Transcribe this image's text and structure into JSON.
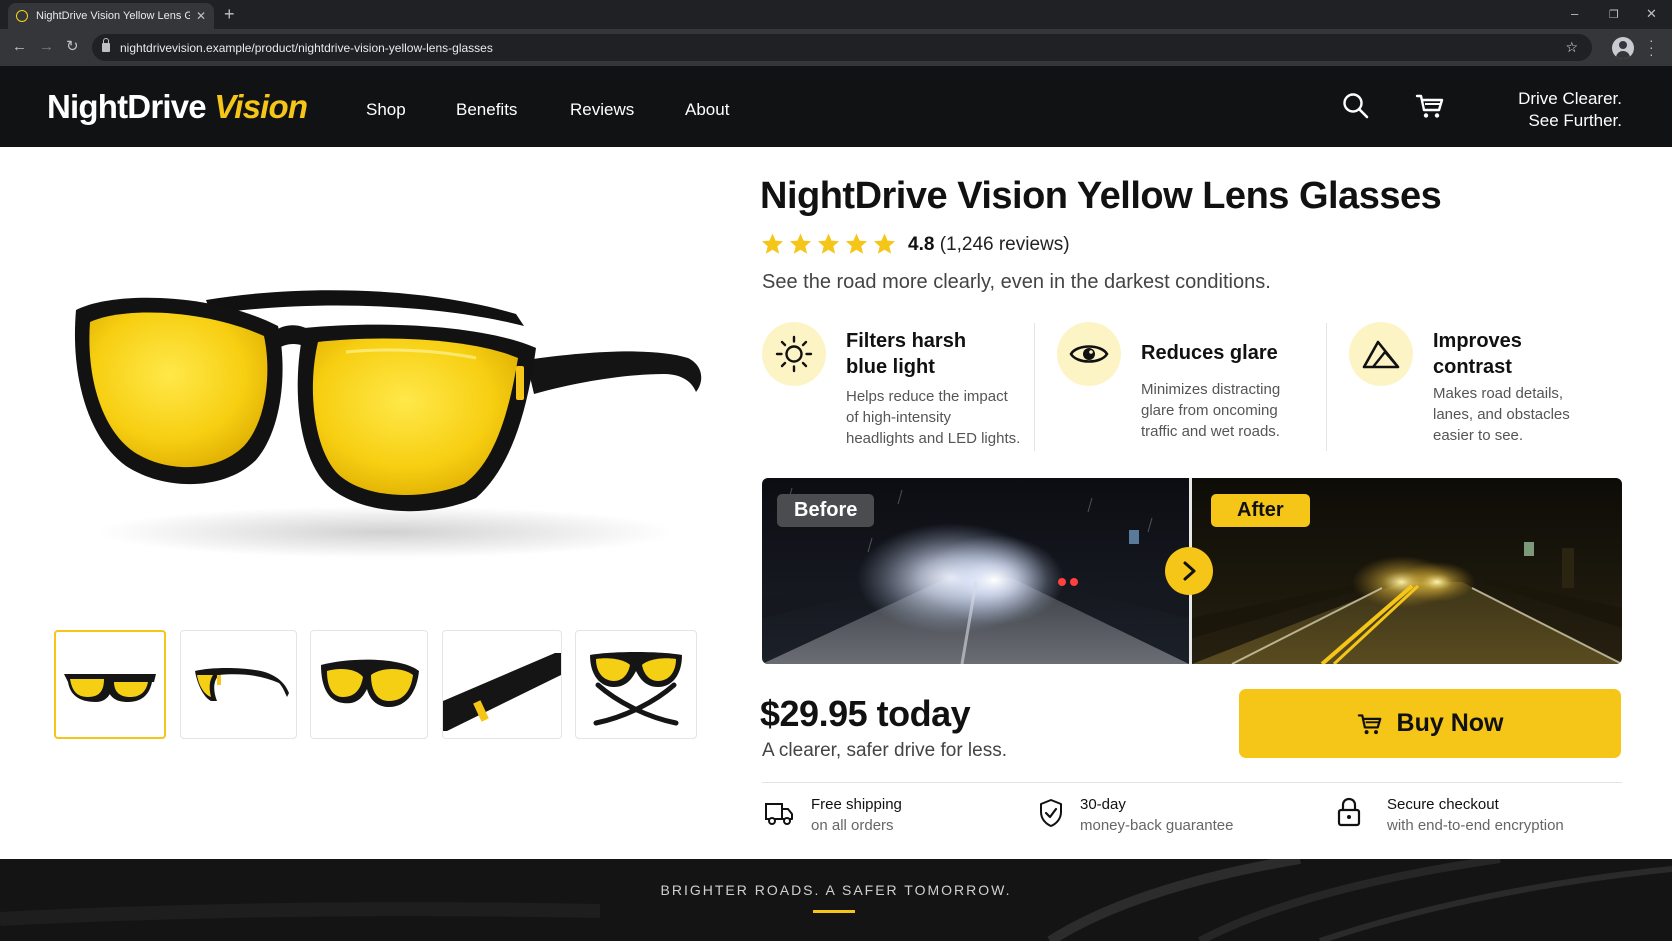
{
  "browser": {
    "tab_title": "NightDrive Vision Yellow Lens Glasses",
    "url": "nightdrivevision.example/product/nightdrive-vision-yellow-lens-glasses"
  },
  "header": {
    "logo_part1": "NightDrive",
    "logo_part2": "Vision",
    "nav": [
      "Shop",
      "Benefits",
      "Reviews",
      "About"
    ],
    "tagline_line1": "Drive Clearer.",
    "tagline_line2": "See Further."
  },
  "product": {
    "title": "NightDrive Vision Yellow Lens Glasses",
    "rating": "4.8",
    "reviews": "(1,246 reviews)",
    "star_count": 5,
    "subtitle": "See the road more clearly, even in the darkest conditions."
  },
  "features": [
    {
      "icon": "sun-icon",
      "title1": "Filters harsh",
      "title2": "blue light",
      "desc": [
        "Helps reduce the impact",
        "of high-intensity",
        "headlights and LED lights."
      ]
    },
    {
      "icon": "eye-icon",
      "title1": "Reduces glare",
      "title2": "",
      "desc": [
        "Minimizes distracting",
        "glare from oncoming",
        "traffic and wet roads."
      ]
    },
    {
      "icon": "mountain-icon",
      "title1": "Improves",
      "title2": "contrast",
      "desc": [
        "Makes road details,",
        "lanes, and obstacles",
        "easier to see."
      ]
    }
  ],
  "comparison": {
    "before_label": "Before",
    "after_label": "After"
  },
  "pricing": {
    "price": "$29.95 today",
    "sub": "A clearer, safer drive for less.",
    "buy_label": "Buy Now"
  },
  "trust": [
    {
      "line1": "Free shipping",
      "line2": "on all orders"
    },
    {
      "line1": "30-day",
      "line2": "money-back guarantee"
    },
    {
      "line1": "Secure checkout",
      "line2": "with end-to-end encryption"
    }
  ],
  "footer": {
    "text": "BRIGHTER ROADS. A SAFER TOMORROW."
  },
  "colors": {
    "accent": "#f5c518",
    "header_bg": "#111214",
    "badge_bg": "#fdf4c6"
  }
}
